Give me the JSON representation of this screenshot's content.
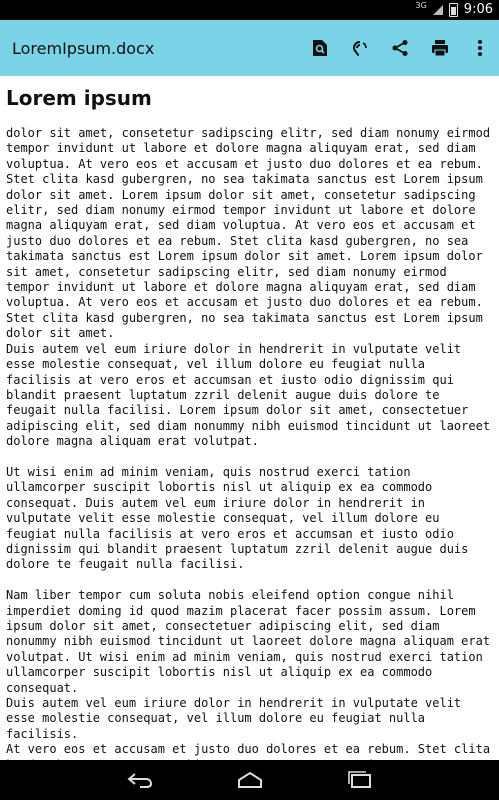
{
  "status_bar": {
    "signal_label": "3G",
    "time": "9:06",
    "icons": [
      "signal-icon",
      "battery-icon"
    ]
  },
  "app_bar": {
    "title": "LoremIpsum.docx",
    "actions": [
      "search-icon",
      "voice-read-icon",
      "share-icon",
      "print-icon",
      "more-icon"
    ]
  },
  "document": {
    "title": "Lorem ipsum",
    "paragraphs": [
      "dolor sit amet, consetetur sadipscing elitr,  sed diam nonumy eirmod tempor invidunt ut labore et dolore magna aliquyam erat, sed diam voluptua. At vero eos et accusam et justo duo dolores et ea rebum. Stet clita kasd gubergren, no sea takimata sanctus est Lorem ipsum dolor sit amet. Lorem ipsum dolor sit amet, consetetur sadipscing elitr,  sed diam nonumy eirmod tempor invidunt ut labore et dolore magna aliquyam erat, sed diam voluptua. At vero eos et accusam et justo duo dolores et ea rebum. Stet clita kasd gubergren, no sea takimata sanctus est Lorem ipsum dolor sit amet. Lorem ipsum dolor sit amet, consetetur sadipscing elitr,  sed diam nonumy eirmod tempor invidunt ut labore et dolore magna aliquyam erat, sed diam voluptua. At vero eos et accusam et justo duo dolores et ea rebum. Stet clita kasd gubergren, no sea takimata sanctus est Lorem ipsum dolor sit amet.",
      "Duis autem vel eum iriure dolor in hendrerit in vulputate velit esse molestie consequat, vel illum dolore eu feugiat nulla facilisis at vero eros et accumsan et iusto odio dignissim qui blandit praesent luptatum zzril delenit augue duis dolore te feugait nulla facilisi. Lorem ipsum dolor sit amet, consectetuer adipiscing elit, sed diam nonummy nibh euismod tincidunt ut laoreet dolore magna aliquam erat volutpat.",
      "Ut wisi enim ad minim veniam, quis nostrud exerci tation ullamcorper suscipit lobortis nisl ut aliquip ex ea commodo consequat. Duis autem vel eum iriure dolor in hendrerit in vulputate velit esse molestie consequat, vel illum dolore eu feugiat nulla facilisis at vero eros et accumsan et iusto odio dignissim qui blandit praesent luptatum zzril delenit augue duis dolore te feugait nulla facilisi.",
      "Nam liber tempor cum soluta nobis eleifend option congue nihil imperdiet doming id quod mazim placerat facer possim assum. Lorem ipsum dolor sit amet, consectetuer adipiscing elit, sed diam nonummy nibh euismod tincidunt ut laoreet dolore magna aliquam erat volutpat. Ut wisi enim ad minim veniam, quis nostrud exerci tation ullamcorper suscipit lobortis nisl ut aliquip ex ea commodo consequat.",
      "Duis autem vel eum iriure dolor in hendrerit in vulputate velit esse molestie consequat, vel illum dolore eu feugiat nulla facilisis.",
      "At vero eos et accusam et justo duo dolores et ea rebum. Stet clita kasd gubergren, no sea takimata sanctus est Lorem ipsum"
    ]
  },
  "nav_bar": {
    "buttons": [
      "back-icon",
      "home-icon",
      "recent-apps-icon"
    ]
  },
  "colors": {
    "app_bar": "#7ad3e6",
    "status_bar": "#000000",
    "nav_bar": "#000000",
    "text": "#111111"
  }
}
